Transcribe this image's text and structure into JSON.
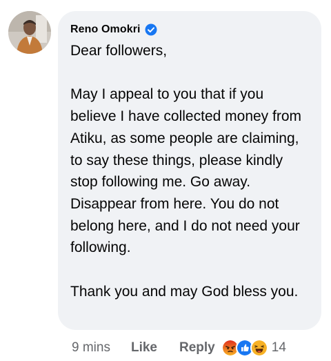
{
  "comment": {
    "author": "Reno Omokri",
    "verified": true,
    "text": "Dear followers,\n\nMay I appeal to you that if you believe I have collected money from Atiku, as some people are claiming, to say these things, please kindly stop following me. Go away. Disappear from here. You do not belong here, and I do not need your following.\n\nThank you and may God bless you.",
    "timestamp": "9 mins",
    "like_label": "Like",
    "reply_label": "Reply",
    "reactions": [
      "angry-icon",
      "like-icon",
      "haha-icon"
    ],
    "reaction_count": "14"
  },
  "colors": {
    "bubble": "#f0f2f5",
    "verified": "#1877f2",
    "meta_text": "#65676b",
    "like_reaction": "#1877f2",
    "angry_reaction": "#e9710f",
    "haha_reaction": "#f7b125"
  }
}
